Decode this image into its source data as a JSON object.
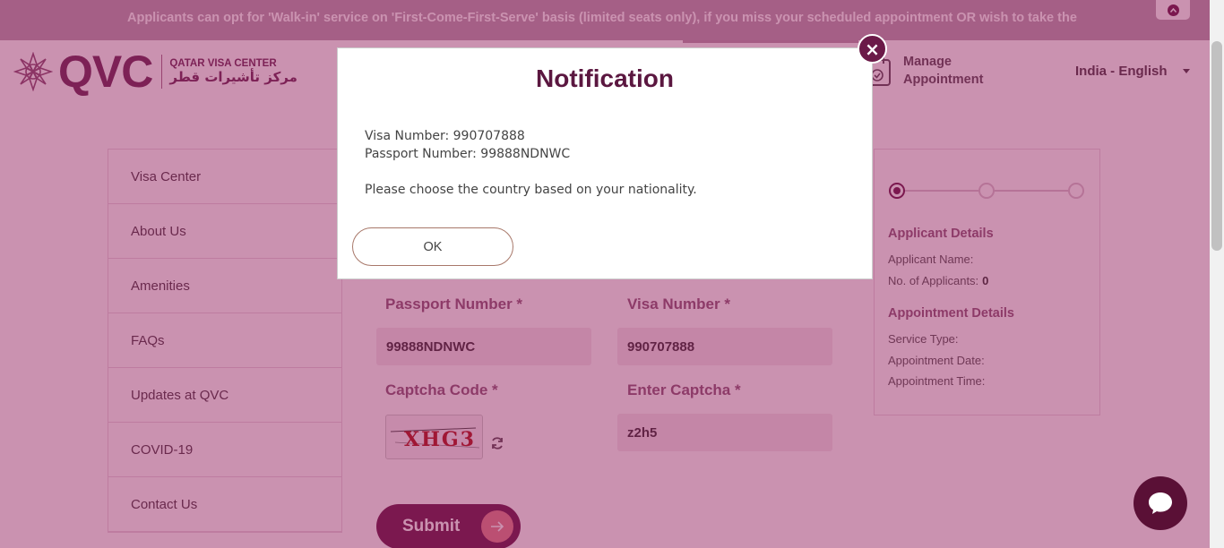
{
  "ticker": {
    "text": "Applicants can opt for 'Walk-in' service on 'First-Come-First-Serve' basis (limited seats only), if you miss your scheduled appointment OR wish to take the"
  },
  "header": {
    "logo_text": "QVC",
    "logo_en": "QATAR VISA CENTER",
    "logo_ar": "مركز تأشيرات قطر",
    "manage_line1": "Manage",
    "manage_line2": "Appointment",
    "language": "India - English"
  },
  "sidebar": {
    "items": [
      {
        "label": "Visa Center"
      },
      {
        "label": "About Us"
      },
      {
        "label": "Amenities"
      },
      {
        "label": "FAQs"
      },
      {
        "label": "Updates at QVC"
      },
      {
        "label": "COVID-19"
      },
      {
        "label": "Contact Us"
      }
    ]
  },
  "form": {
    "passport_label": "Passport Number *",
    "passport_value": "99888NDNWC",
    "visa_label": "Visa Number *",
    "visa_value": "990707888",
    "captcha_label": "Captcha Code *",
    "captcha_text": "XHG3",
    "enter_captcha_label": "Enter Captcha *",
    "enter_captcha_value": "z2h5",
    "submit_label": "Submit"
  },
  "summary": {
    "applicant_heading": "Applicant Details",
    "applicant_name_label": "Applicant Name:",
    "applicants_count_label": "No. of Applicants:",
    "applicants_count": "0",
    "appointment_heading": "Appointment Details",
    "service_type_label": "Service Type:",
    "appointment_date_label": "Appointment Date:",
    "appointment_time_label": "Appointment Time:"
  },
  "modal": {
    "title": "Notification",
    "visa_line": "Visa Number: 990707888",
    "passport_line": "Passport Number: 99888NDNWC",
    "message": "Please choose the country based on your nationality.",
    "ok_label": "OK",
    "close_glyph": "×"
  },
  "colors": {
    "brand": "#6b1a48",
    "overlay": "rgba(142,24,88,0.47)",
    "accent": "#e2808a"
  }
}
